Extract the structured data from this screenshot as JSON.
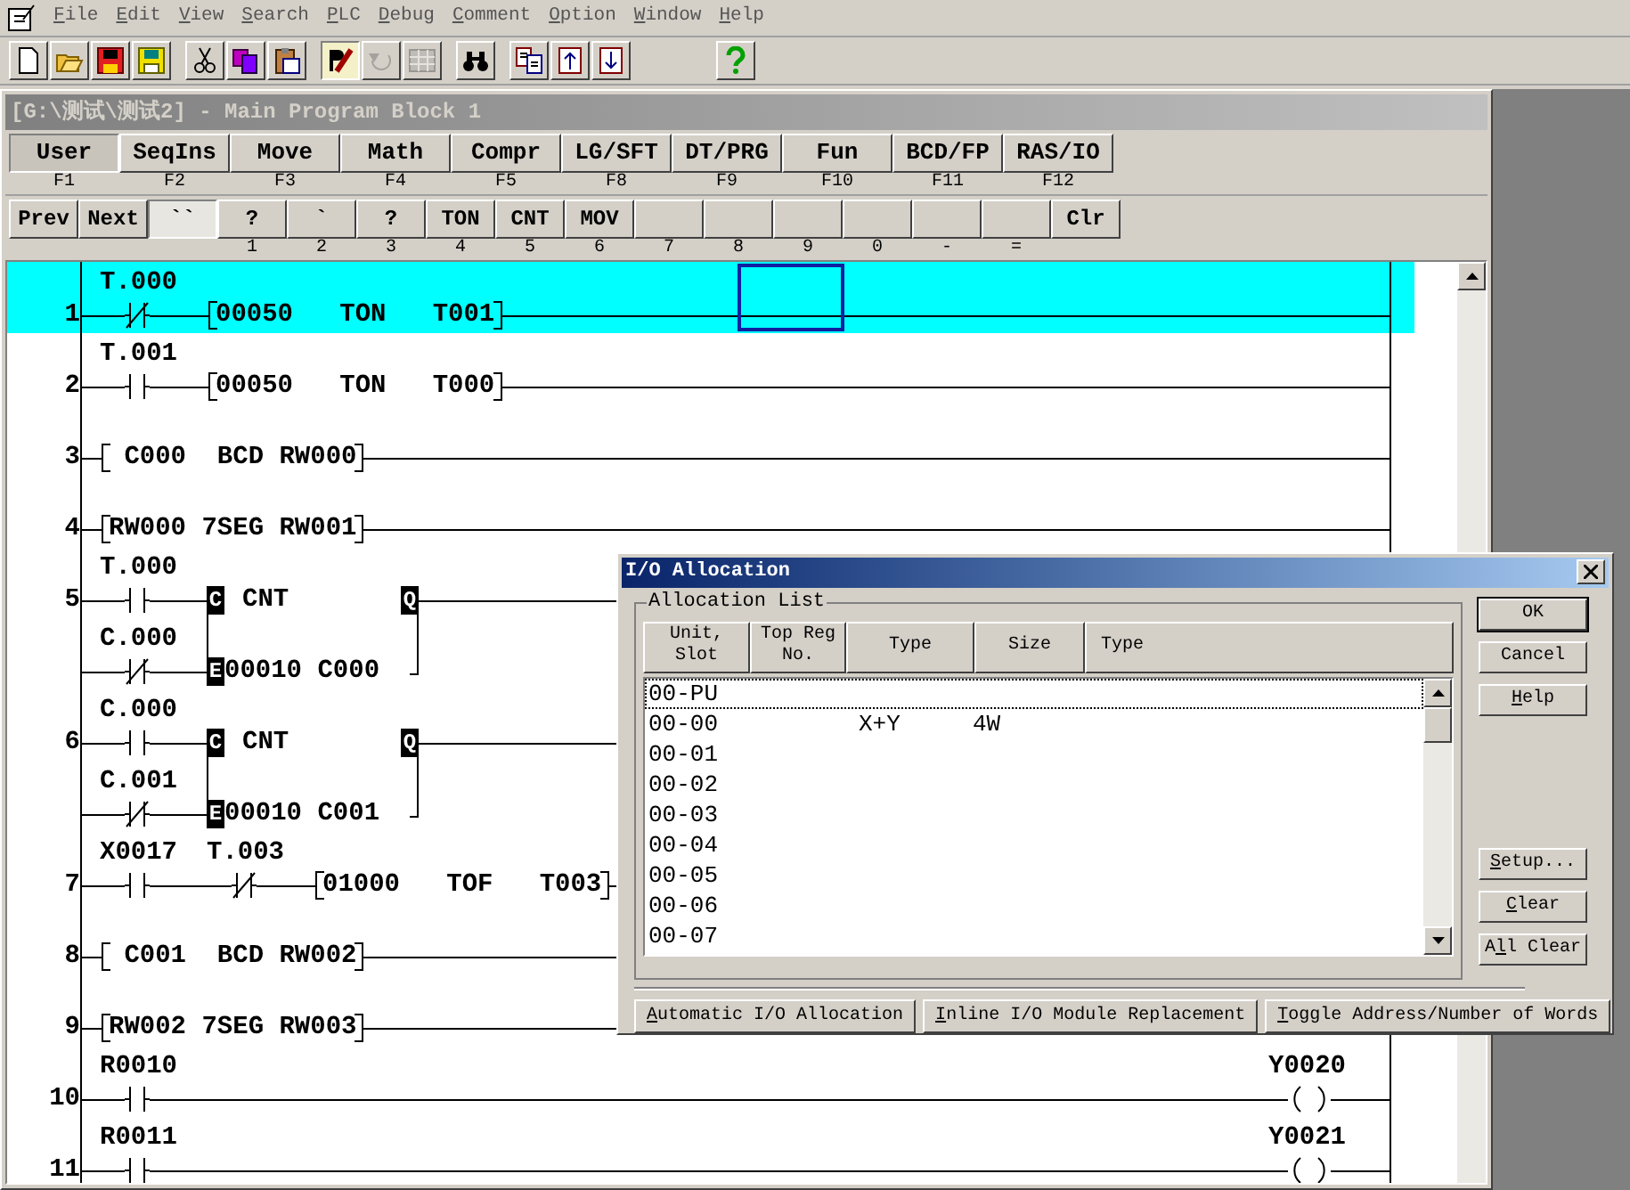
{
  "menu": [
    {
      "key": "F",
      "after": "ile"
    },
    {
      "key": "E",
      "after": "dit"
    },
    {
      "key": "V",
      "after": "iew"
    },
    {
      "key": "S",
      "after": "earch"
    },
    {
      "key": "P",
      "after": "LC"
    },
    {
      "key": "D",
      "after": "ebug"
    },
    {
      "key": "C",
      "after": "omment"
    },
    {
      "key": "O",
      "after": "ption"
    },
    {
      "key": "W",
      "after": "indow"
    },
    {
      "key": "H",
      "after": "elp"
    }
  ],
  "toolbar": [
    {
      "items": [
        {
          "kind": "new",
          "pressed": false,
          "disabled": false
        },
        {
          "kind": "open",
          "pressed": false,
          "disabled": false
        },
        {
          "kind": "save_red",
          "pressed": false,
          "disabled": false
        },
        {
          "kind": "save",
          "pressed": false,
          "disabled": false
        }
      ]
    },
    {
      "items": [
        {
          "kind": "cut",
          "pressed": false,
          "disabled": false
        },
        {
          "kind": "copy",
          "pressed": false,
          "disabled": false
        },
        {
          "kind": "paste",
          "pressed": false,
          "disabled": false
        }
      ]
    },
    {
      "items": [
        {
          "kind": "edit",
          "pressed": true,
          "disabled": false
        },
        {
          "kind": "undo",
          "pressed": false,
          "disabled": true
        },
        {
          "kind": "grid",
          "pressed": false,
          "disabled": true
        }
      ]
    },
    {
      "items": [
        {
          "kind": "find",
          "pressed": false,
          "disabled": false
        }
      ]
    },
    {
      "items": [
        {
          "kind": "transfer",
          "pressed": false,
          "disabled": false
        },
        {
          "kind": "upload",
          "pressed": false,
          "disabled": false
        },
        {
          "kind": "download",
          "pressed": false,
          "disabled": false
        }
      ]
    },
    {
      "items": [
        {
          "kind": "help",
          "pressed": false,
          "disabled": false
        }
      ]
    }
  ],
  "window": {
    "title": "[G:\\测试\\测试2] - Main Program Block 1"
  },
  "function_keys": [
    {
      "label": "User",
      "key": "F1",
      "selected": true
    },
    {
      "label": "SeqIns",
      "key": "F2",
      "selected": false
    },
    {
      "label": "Move",
      "key": "F3",
      "selected": false
    },
    {
      "label": "Math",
      "key": "F4",
      "selected": false
    },
    {
      "label": "Compr",
      "key": "F5",
      "selected": false
    },
    {
      "label": "LG/SFT",
      "key": "F8",
      "selected": false
    },
    {
      "label": "DT/PRG",
      "key": "F9",
      "selected": false
    },
    {
      "label": "Fun",
      "key": "F10",
      "selected": false
    },
    {
      "label": "BCD/FP",
      "key": "F11",
      "selected": false
    },
    {
      "label": "RAS/IO",
      "key": "F12",
      "selected": false
    }
  ],
  "edit_keys": [
    {
      "label": "Prev",
      "selected": false
    },
    {
      "label": "Next",
      "selected": false
    },
    {
      "label": "``",
      "selected": true
    },
    {
      "label": "?",
      "key": "1",
      "selected": false
    },
    {
      "label": "`",
      "key": "2",
      "selected": false
    },
    {
      "label": "?",
      "key": "3",
      "selected": false
    },
    {
      "label": "TON",
      "key": "4",
      "selected": false
    },
    {
      "label": "CNT",
      "key": "5",
      "selected": false
    },
    {
      "label": "MOV",
      "key": "6",
      "selected": false
    },
    {
      "key": "7",
      "selected": false
    },
    {
      "key": "8",
      "selected": false
    },
    {
      "key": "9",
      "selected": false
    },
    {
      "key": "0",
      "selected": false
    },
    {
      "key": "-",
      "selected": false
    },
    {
      "key": "=",
      "selected": false
    },
    {
      "label": "Clr",
      "selected": false
    }
  ],
  "ladder": {
    "rungs": [
      {
        "number": "1",
        "kind": "simple",
        "selected": true,
        "elements": [
          {
            "kind": "contact_nc",
            "label": "T.000"
          },
          {
            "kind": "box",
            "text": "00050   TON   T001"
          }
        ]
      },
      {
        "number": "2",
        "kind": "simple",
        "selected": false,
        "elements": [
          {
            "kind": "contact_no",
            "label": "T.001"
          },
          {
            "kind": "box",
            "text": "00050   TON   T000"
          }
        ]
      },
      {
        "number": "3",
        "kind": "simple",
        "selected": false,
        "elements": [
          {
            "kind": "box",
            "text": " C000  BCD RW000"
          }
        ]
      },
      {
        "number": "4",
        "kind": "simple",
        "selected": false,
        "elements": [
          {
            "kind": "box",
            "text": "RW000 7SEG RW001"
          }
        ]
      },
      {
        "number": "5",
        "kind": "counter",
        "selected": false,
        "inputs": [
          {
            "kind": "contact_no",
            "label": "T.000"
          },
          {
            "kind": "contact_nc",
            "label": "C.000"
          }
        ],
        "counter": {
          "clock_pin": "C",
          "instruction": "CNT",
          "output_pin": "Q",
          "reset_pin": "E",
          "operand": "00010 C000"
        }
      },
      {
        "number": "6",
        "kind": "counter",
        "selected": false,
        "inputs": [
          {
            "kind": "contact_no",
            "label": "C.000"
          },
          {
            "kind": "contact_nc",
            "label": "C.001"
          }
        ],
        "counter": {
          "clock_pin": "C",
          "instruction": "CNT",
          "output_pin": "Q",
          "reset_pin": "E",
          "operand": "00010 C001"
        }
      },
      {
        "number": "7",
        "kind": "simple",
        "selected": false,
        "elements": [
          {
            "kind": "contact_no",
            "label": "X0017"
          },
          {
            "kind": "contact_nc",
            "label": "T.003"
          },
          {
            "kind": "box",
            "text": "01000   TOF   T003"
          }
        ]
      },
      {
        "number": "8",
        "kind": "simple",
        "selected": false,
        "elements": [
          {
            "kind": "box",
            "text": " C001  BCD RW002"
          }
        ]
      },
      {
        "number": "9",
        "kind": "simple",
        "selected": false,
        "elements": [
          {
            "kind": "box",
            "text": "RW002 7SEG RW003"
          }
        ]
      },
      {
        "number": "10",
        "kind": "simple",
        "selected": false,
        "elements": [
          {
            "kind": "contact_no",
            "label": "R0010"
          },
          {
            "kind": "coil",
            "label": "Y0020"
          }
        ]
      },
      {
        "number": "11",
        "kind": "simple",
        "selected": false,
        "elements": [
          {
            "kind": "contact_no",
            "label": "R0011"
          },
          {
            "kind": "coil",
            "label": "Y0021"
          }
        ]
      }
    ]
  },
  "dialog": {
    "title": "I/O Allocation",
    "group": "Allocation List",
    "columns": [
      "Unit, Slot",
      "Top Reg No.",
      "Type",
      "Size",
      "Type"
    ],
    "rows": [
      {
        "unit": "00-PU",
        "selected": true
      },
      {
        "unit": "00-00",
        "type": "X+Y",
        "size": "4W",
        "selected": false
      },
      {
        "unit": "00-01",
        "selected": false
      },
      {
        "unit": "00-02",
        "selected": false
      },
      {
        "unit": "00-03",
        "selected": false
      },
      {
        "unit": "00-04",
        "selected": false
      },
      {
        "unit": "00-05",
        "selected": false
      },
      {
        "unit": "00-06",
        "selected": false
      },
      {
        "unit": "00-07",
        "selected": false
      }
    ],
    "side_buttons": [
      {
        "label": "OK",
        "default": true
      },
      {
        "label": "Cancel",
        "default": false
      },
      {
        "key": "H",
        "after": "elp",
        "default": false
      }
    ],
    "lower_side_buttons": [
      {
        "key": "S",
        "after": "etup..."
      },
      {
        "key": "C",
        "after": "lear"
      },
      {
        "before": "A",
        "key": "l",
        "after": "l Clear"
      }
    ],
    "bottom_buttons": [
      {
        "key": "A",
        "after": "utomatic I/O Allocation"
      },
      {
        "key": "I",
        "after": "nline I/O Module Replacement"
      },
      {
        "key": "T",
        "after": "oggle Address/Number of Words"
      }
    ]
  }
}
